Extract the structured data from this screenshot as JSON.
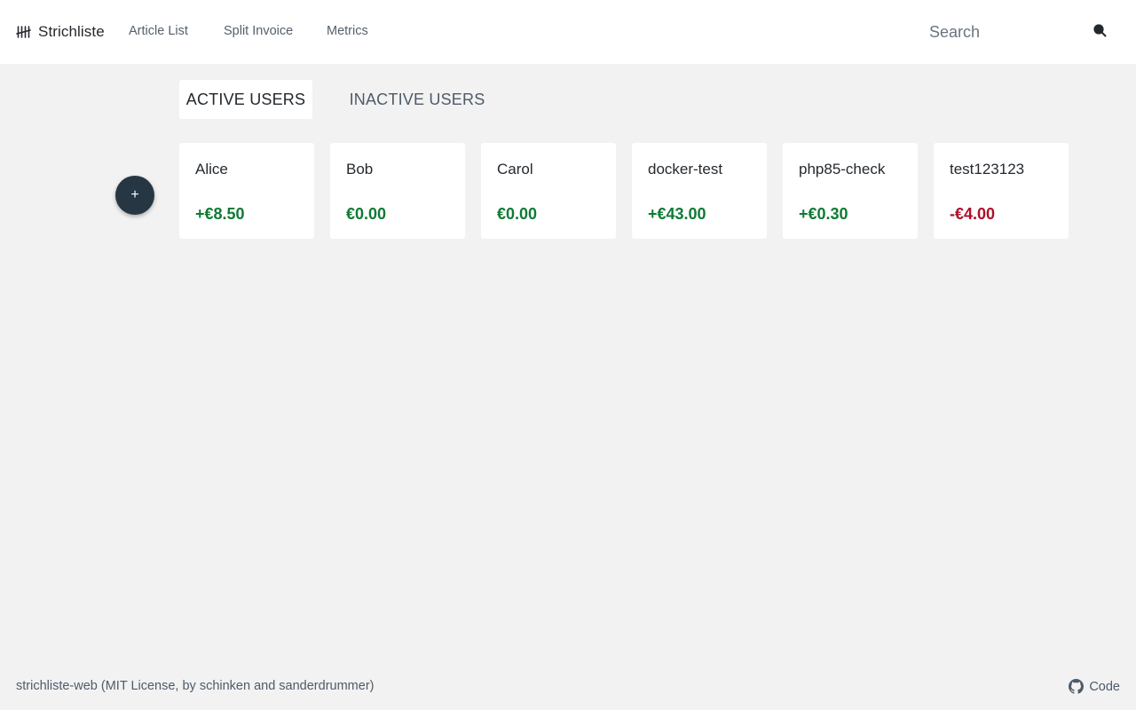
{
  "header": {
    "brand_icon": "tally-marks-icon",
    "brand_title": "Strichliste",
    "nav": [
      {
        "label": "Article List"
      },
      {
        "label": "Split Invoice"
      },
      {
        "label": "Metrics"
      }
    ],
    "search": {
      "placeholder": "Search",
      "value": "",
      "icon": "search-icon"
    }
  },
  "tabs": [
    {
      "label": "ACTIVE USERS",
      "active": true
    },
    {
      "label": "INACTIVE USERS",
      "active": false
    }
  ],
  "fab": {
    "label": "+",
    "icon": "add-icon"
  },
  "users": [
    {
      "name": "Alice",
      "balance": "+€8.50",
      "status": "positive"
    },
    {
      "name": "Bob",
      "balance": "€0.00",
      "status": "positive"
    },
    {
      "name": "Carol",
      "balance": "€0.00",
      "status": "positive"
    },
    {
      "name": "docker-test",
      "balance": "+€43.00",
      "status": "positive"
    },
    {
      "name": "php85-check",
      "balance": "+€0.30",
      "status": "positive"
    },
    {
      "name": "test123123",
      "balance": "-€4.00",
      "status": "negative"
    }
  ],
  "footer": {
    "text": "strichliste-web (MIT License, by schinken and sanderdrummer)",
    "code_label": "Code",
    "code_icon": "github-icon"
  },
  "colors": {
    "positive": "#0e7a34",
    "negative": "#b00d2a",
    "fab": "#263743",
    "background": "#f2f2f2"
  }
}
